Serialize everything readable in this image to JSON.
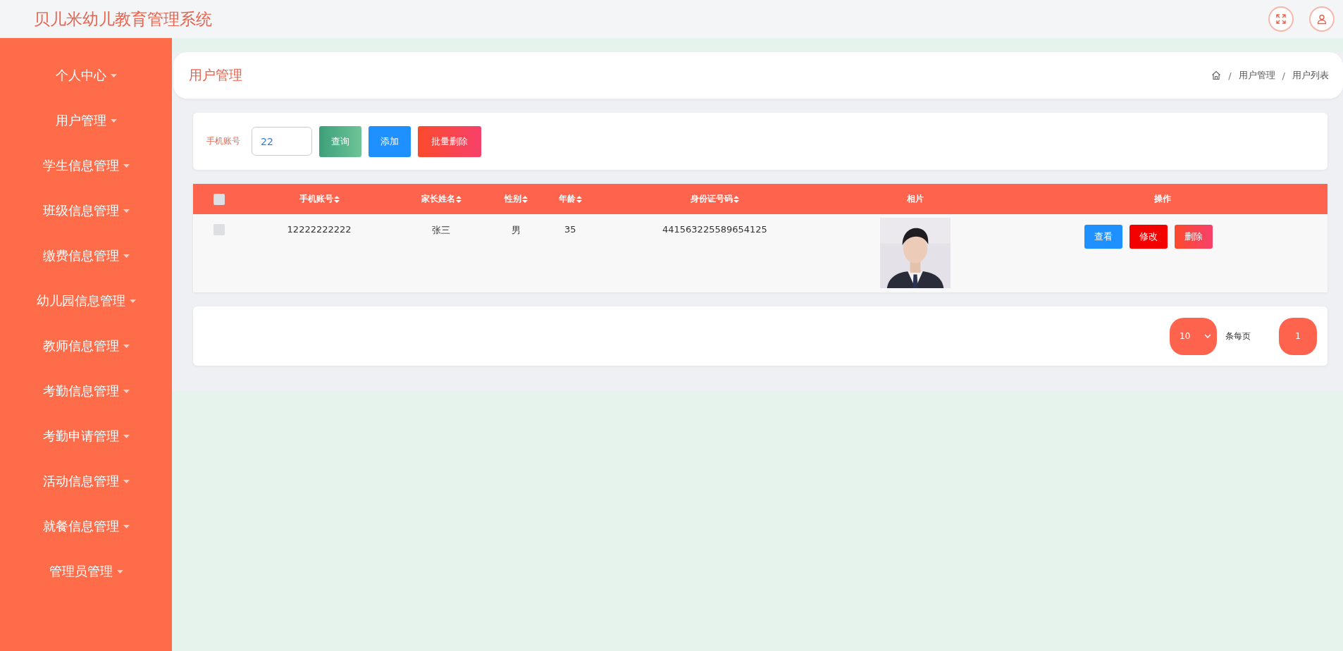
{
  "app_title": "贝儿米幼儿教育管理系统",
  "sidebar": {
    "items": [
      {
        "label": "个人中心"
      },
      {
        "label": "用户管理"
      },
      {
        "label": "学生信息管理"
      },
      {
        "label": "班级信息管理"
      },
      {
        "label": "缴费信息管理"
      },
      {
        "label": "幼儿园信息管理"
      },
      {
        "label": "教师信息管理"
      },
      {
        "label": "考勤信息管理"
      },
      {
        "label": "考勤申请管理"
      },
      {
        "label": "活动信息管理"
      },
      {
        "label": "就餐信息管理"
      },
      {
        "label": "管理员管理"
      }
    ]
  },
  "page_title": "用户管理",
  "breadcrumb": [
    "用户管理",
    "用户列表"
  ],
  "breadcrumb_separator": "/",
  "search": {
    "label": "手机账号",
    "value": "22",
    "buttons": [
      {
        "label": "查询",
        "kind": "search"
      },
      {
        "label": "添加",
        "kind": "add"
      },
      {
        "label": "批量删除",
        "kind": "delete"
      }
    ]
  },
  "table": {
    "select_all_checked": false,
    "columns": [
      {
        "label": "手机账号",
        "sortable": true
      },
      {
        "label": "家长姓名",
        "sortable": true
      },
      {
        "label": "性别",
        "sortable": true
      },
      {
        "label": "年龄",
        "sortable": true
      },
      {
        "label": "身份证号码",
        "sortable": true
      },
      {
        "label": "相片",
        "sortable": false
      },
      {
        "label": "操作",
        "sortable": false
      }
    ],
    "rows": [
      {
        "checked": false,
        "cells": [
          "12222222222",
          "张三",
          "男",
          "35",
          "441563225589654125"
        ],
        "actions": [
          {
            "label": "查看",
            "kind": "view"
          },
          {
            "label": "修改",
            "kind": "edit"
          },
          {
            "label": "删除",
            "kind": "delete"
          }
        ]
      }
    ]
  },
  "pagination": {
    "page_size": "10",
    "per_page_label": "条每页",
    "pages": [
      {
        "label": "1",
        "selected": true
      }
    ]
  }
}
